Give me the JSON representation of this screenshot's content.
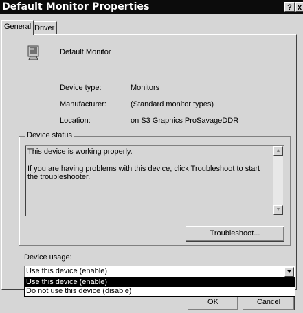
{
  "window": {
    "title": "Default Monitor Properties",
    "help_button": "?",
    "close_button": "x"
  },
  "tabs": [
    {
      "label": "General"
    },
    {
      "label": "Driver"
    }
  ],
  "device": {
    "name": "Default Monitor",
    "icon": "monitor-icon",
    "type_label": "Device type:",
    "type_value": "Monitors",
    "manufacturer_label": "Manufacturer:",
    "manufacturer_value": "(Standard monitor types)",
    "location_label": "Location:",
    "location_value": "on S3 Graphics ProSavageDDR"
  },
  "status": {
    "group_title": "Device status",
    "line1": "This device is working properly.",
    "line2": "If you are having problems with this device, click Troubleshoot to start the troubleshooter.",
    "troubleshoot_button": "Troubleshoot..."
  },
  "usage": {
    "label": "Device usage:",
    "selected": "Use this device (enable)",
    "options": [
      "Use this device (enable)",
      "Do not use this device (disable)"
    ]
  },
  "footer": {
    "ok_button": "OK",
    "cancel_button": "Cancel"
  }
}
